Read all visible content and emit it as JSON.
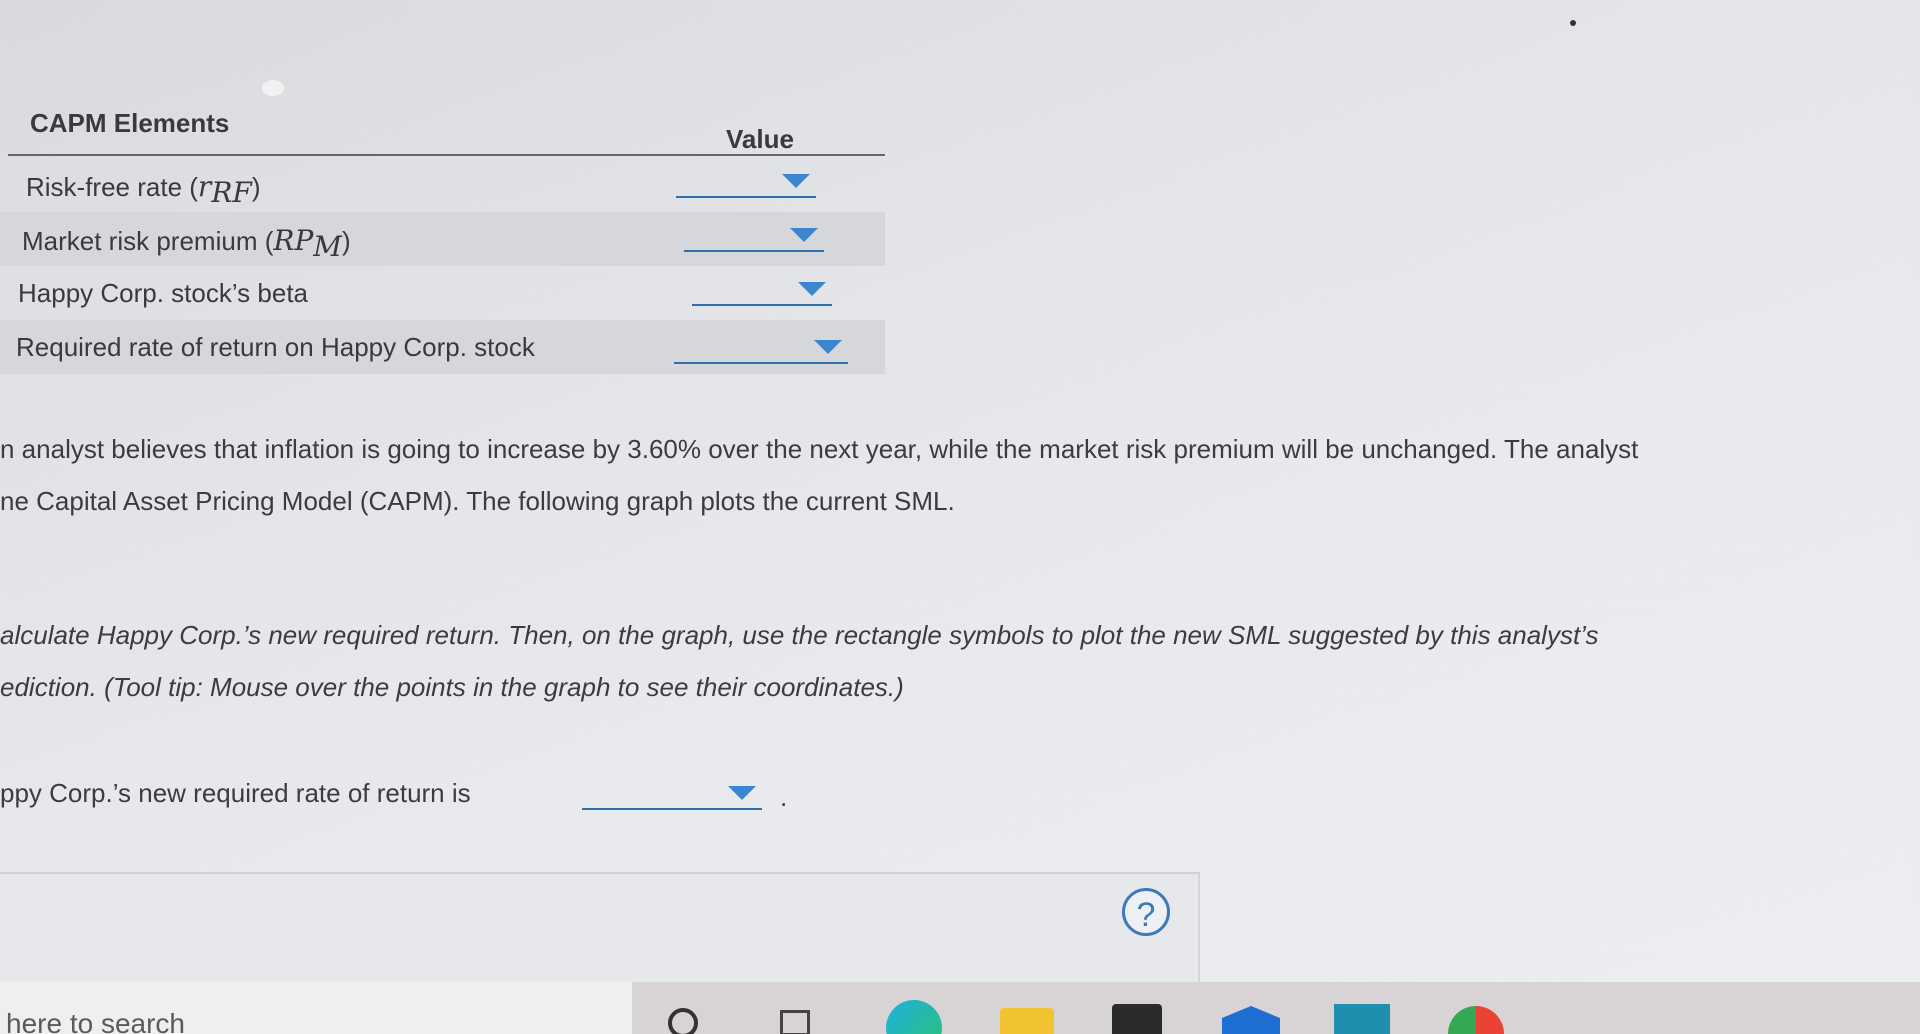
{
  "table": {
    "header_label": "CAPM Elements",
    "header_value": "Value",
    "rows": [
      {
        "prefix": "Risk-free rate (",
        "symbol": "r",
        "sub": "RF",
        "suffix": ")"
      },
      {
        "prefix": "Market risk premium (",
        "symbol": "RP",
        "sub": "M",
        "suffix": ")"
      },
      {
        "prefix": "Happy Corp. stock’s beta",
        "symbol": "",
        "sub": "",
        "suffix": ""
      },
      {
        "prefix": "Required rate of return on Happy Corp. stock",
        "symbol": "",
        "sub": "",
        "suffix": ""
      }
    ]
  },
  "paragraphs": {
    "analyst_line1": "n analyst believes that inflation is going to increase by 3.60% over the next year, while the market risk premium will be unchanged. The analyst",
    "analyst_line2": "ne Capital Asset Pricing Model (CAPM). The following graph plots the current SML.",
    "instruction_line1": "alculate Happy Corp.’s new required return. Then, on the graph, use the rectangle symbols to plot the new SML suggested by this analyst’s",
    "instruction_line2": "ediction. (Tool tip: Mouse over the points in the graph to see their coordinates.)"
  },
  "answer": {
    "text": "ppy Corp.’s new required rate of return is",
    "suffix": "."
  },
  "help": {
    "glyph": "?"
  },
  "taskbar": {
    "search_placeholder": "here to search",
    "icons": [
      "cortana-icon",
      "task-view-icon",
      "edge-icon",
      "file-explorer-icon",
      "store-icon",
      "mail-icon",
      "app-icon",
      "chrome-icon"
    ]
  }
}
